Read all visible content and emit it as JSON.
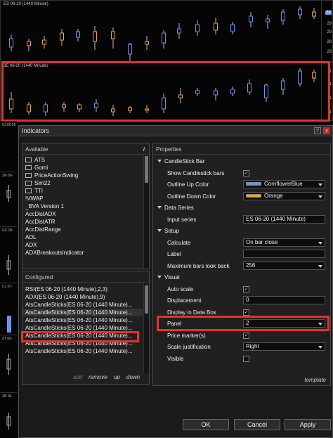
{
  "top_chart": {
    "title": "ES 06-20 (1440 Minute)",
    "axis_labels": [
      "30",
      "29",
      "29",
      "28",
      "28"
    ],
    "price_tag": "30",
    "up_color": "#6495ed",
    "down_color": "#f0a030"
  },
  "second_chart": {
    "title": "3E 06-20 (1440 Minute)",
    "axis_labels": [
      "1",
      "1",
      "1",
      "1"
    ]
  },
  "side_charts": [
    {
      "label": "6J 06-20"
    },
    {
      "label": "ZN 06-"
    },
    {
      "label": "GC 06-"
    },
    {
      "label": "CL 07-"
    },
    {
      "label": "ZT 06-"
    },
    {
      "label": "ZB 06-"
    }
  ],
  "dialog": {
    "title": "Indicators",
    "help": "?",
    "close": "x",
    "available": {
      "header": "Available",
      "info_icon": "i",
      "items": [
        {
          "label": "ATS",
          "folder": true
        },
        {
          "label": "Gomi",
          "folder": true
        },
        {
          "label": "PriceActionSwing",
          "folder": true
        },
        {
          "label": "Sim22",
          "folder": true
        },
        {
          "label": "TTI",
          "folder": true
        },
        {
          "label": "!VWAP",
          "folder": false
        },
        {
          "label": "_BVA Version 1",
          "folder": false
        },
        {
          "label": "AccDistADX",
          "folder": false
        },
        {
          "label": "AccDistATR",
          "folder": false
        },
        {
          "label": "AccDistRange",
          "folder": false
        },
        {
          "label": "ADL",
          "folder": false
        },
        {
          "label": "ADX",
          "folder": false
        },
        {
          "label": "ADXBreakoutsIndicator",
          "folder": false
        }
      ]
    },
    "configured": {
      "header": "Configured",
      "items": [
        "RSI(ES 06-20 (1440 Minute),2,3)",
        "ADX(ES 06-20 (1440 Minute),9)",
        "AtsCandleSticks(ES 06-20 (1440 Minute)...",
        "AtsCandleSticks(ES 06-20 (1440 Minute)...",
        "AtsCandleSticks(ES 06-20 (1440 Minute)...",
        "AtsCandleSticks(ES 06-20 (1440 Minute)...",
        "AtsCandleSticks(ES 06-20 (1440 Minute)...",
        "AtsCandleSticks(ES 06-20 (1440 Minute)...",
        "AtsCandleSticks(ES 06-20 (1440 Minute)..."
      ],
      "actions": {
        "add": "add",
        "remove": "remove",
        "up": "up",
        "down": "down"
      }
    },
    "properties": {
      "header": "Properties",
      "sections": [
        {
          "title": "CandleStick Bar",
          "rows": [
            {
              "name": "Show Candlestick bars",
              "type": "check",
              "checked": true
            },
            {
              "name": "Outline Up Color",
              "type": "color",
              "value": "CornflowerBlue",
              "color": "#6495ed"
            },
            {
              "name": "Outline Down Color",
              "type": "color",
              "value": "Orange",
              "color": "#ffa500"
            }
          ]
        },
        {
          "title": "Data Series",
          "rows": [
            {
              "name": "Input series",
              "type": "text",
              "value": "ES 06-20 (1440 Minute)"
            }
          ]
        },
        {
          "title": "Setup",
          "rows": [
            {
              "name": "Calculate",
              "type": "select",
              "value": "On bar close"
            },
            {
              "name": "Label",
              "type": "text",
              "value": ""
            },
            {
              "name": "Maximum bars look back",
              "type": "select",
              "value": "256"
            }
          ]
        },
        {
          "title": "Visual",
          "rows": [
            {
              "name": "Auto scale",
              "type": "check",
              "checked": true
            },
            {
              "name": "Displacement",
              "type": "text",
              "value": "0"
            },
            {
              "name": "Display in Data Box",
              "type": "check",
              "checked": true
            },
            {
              "name": "Panel",
              "type": "select",
              "value": "2"
            },
            {
              "name": "Price marker(s)",
              "type": "check",
              "checked": true
            },
            {
              "name": "Scale justification",
              "type": "select",
              "value": "Right"
            },
            {
              "name": "Visible",
              "type": "check",
              "checked": false
            }
          ]
        }
      ],
      "footer": "template"
    },
    "buttons": {
      "ok": "OK",
      "cancel": "Cancel",
      "apply": "Apply"
    }
  }
}
